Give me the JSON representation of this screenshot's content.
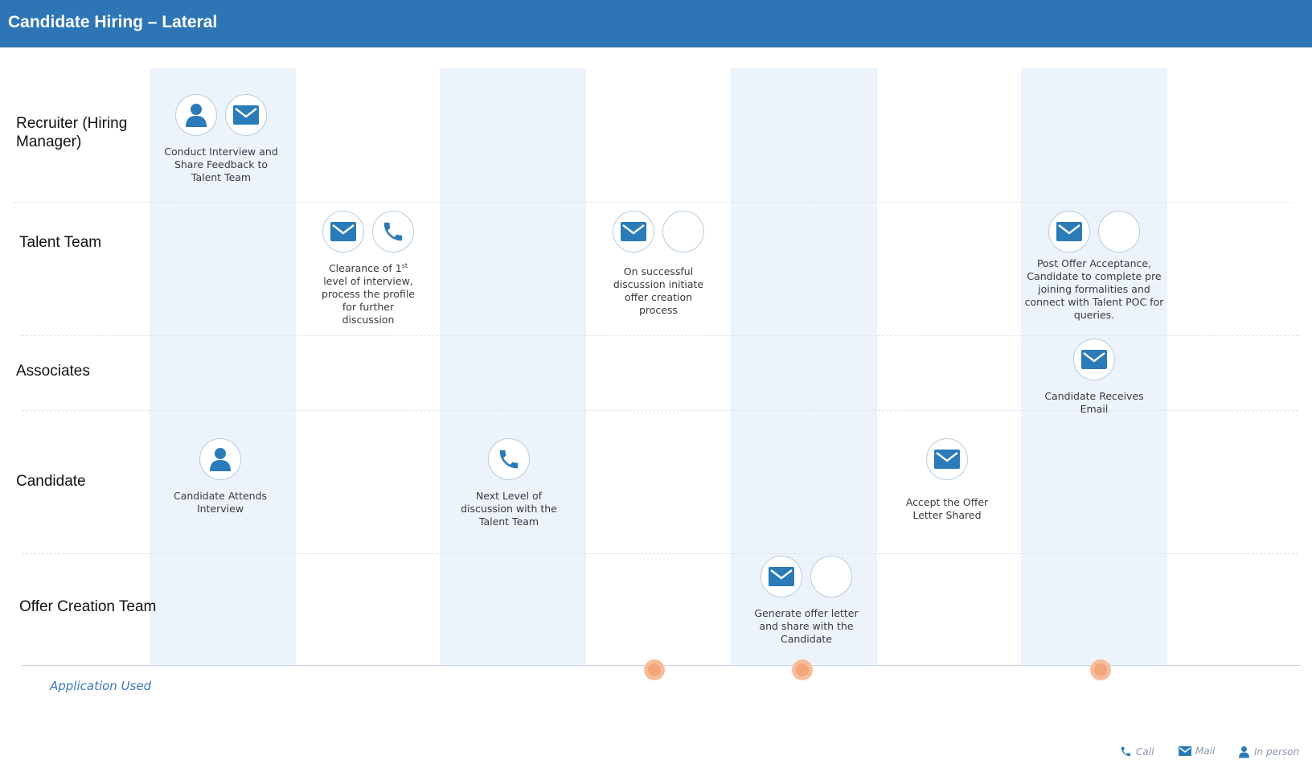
{
  "header": {
    "title": "Candidate Hiring – Lateral"
  },
  "lanes": [
    "Recruiter (Hiring Manager)",
    "Talent Team",
    "Associates",
    "Candidate",
    "Offer Creation Team"
  ],
  "steps": {
    "conduct_interview": {
      "text": "Conduct Interview and Share Feedback to Talent Team",
      "icons": [
        "person-icon",
        "mail-icon"
      ]
    },
    "clearance": {
      "text_before": "Clearance of 1",
      "superscript": "st",
      "text_after": " level of interview, process the profile for further discussion",
      "icons": [
        "mail-icon",
        "phone-icon"
      ]
    },
    "initiate_offer": {
      "text": "On successful discussion initiate offer creation process",
      "icons": [
        "mail-icon",
        "empty-icon"
      ]
    },
    "post_offer": {
      "text": "Post Offer Acceptance, Candidate to complete pre joining formalities and connect with Talent POC for queries.",
      "icons": [
        "mail-icon",
        "empty-icon"
      ]
    },
    "receives_email": {
      "text": "Candidate Receives Email",
      "icons": [
        "mail-icon"
      ]
    },
    "attends_interview": {
      "text": "Candidate Attends Interview",
      "icons": [
        "person-icon"
      ]
    },
    "next_level": {
      "text": "Next Level of discussion with the Talent Team",
      "icons": [
        "phone-icon"
      ]
    },
    "accept_offer": {
      "text": "Accept the Offer Letter Shared",
      "icons": [
        "mail-icon"
      ]
    },
    "generate_offer": {
      "text": "Generate offer letter and share with the Candidate",
      "icons": [
        "mail-icon",
        "empty-icon"
      ]
    }
  },
  "footer": {
    "application_label": "Application Used",
    "legend": {
      "call": "Call",
      "mail": "Mail",
      "in_person": "In person"
    }
  },
  "colors": {
    "header": "#2e75b6",
    "icon": "#2b7bb9",
    "column_band": "#ecf3fb",
    "application_dot": "#f7bd9a"
  }
}
